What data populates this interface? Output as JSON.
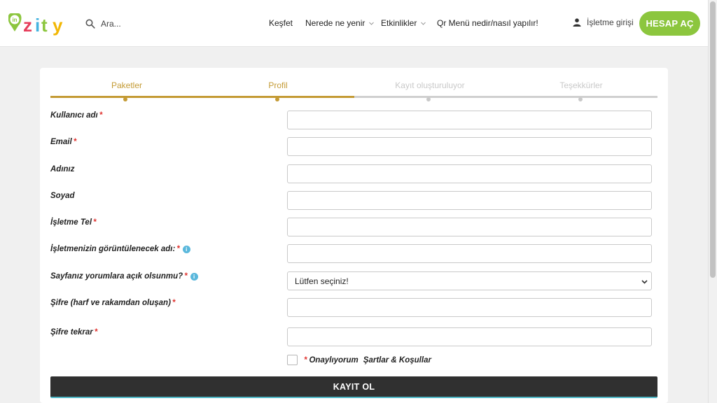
{
  "header": {
    "logo_text": "inzity",
    "search_placeholder": "Ara...",
    "nav": [
      {
        "label": "Keşfet",
        "has_caret": false
      },
      {
        "label": "Nerede ne yenir",
        "has_caret": true
      },
      {
        "label": "Etkinlikler",
        "has_caret": true
      },
      {
        "label": "Qr Menü nedir/nasıl yapılır!",
        "has_caret": false
      }
    ],
    "login_label": "İşletme girişi",
    "account_button": "HESAP AÇ"
  },
  "steps": [
    {
      "label": "Paketler",
      "status": "done"
    },
    {
      "label": "Profil",
      "status": "done"
    },
    {
      "label": "Kayıt oluşturuluyor",
      "status": "todo"
    },
    {
      "label": "Teşekkürler",
      "status": "todo"
    }
  ],
  "form": {
    "fields": [
      {
        "label": "Kullanıcı adı",
        "required": true,
        "info": false,
        "value": ""
      },
      {
        "label": "Email",
        "required": true,
        "info": false,
        "value": ""
      },
      {
        "label": "Adınız",
        "required": false,
        "info": false,
        "value": ""
      },
      {
        "label": "Soyad",
        "required": false,
        "info": false,
        "value": ""
      },
      {
        "label": "İşletme Tel",
        "required": true,
        "info": false,
        "value": ""
      },
      {
        "label": "İşletmenizin görüntülenecek adı:",
        "required": true,
        "info": true,
        "value": ""
      },
      {
        "label": "Sayfanız yorumlara açık olsunmu?",
        "required": true,
        "info": true,
        "select_value": "Lütfen seçiniz!"
      },
      {
        "label": "Şifre (harf ve rakamdan oluşan)",
        "required": true,
        "info": false,
        "value": ""
      },
      {
        "label": "Şifre tekrar",
        "required": true,
        "info": false,
        "value": ""
      }
    ],
    "required_mark": "*",
    "info_glyph": "i",
    "agree_text": "Onaylıyorum",
    "terms_text": "Şartlar & Koşullar",
    "submit_label": "KAYIT OL"
  },
  "colors": {
    "brand_green": "#8cc63e",
    "step_done": "#c49b35",
    "step_todo": "#d0d0d0",
    "required": "#e0332f",
    "info": "#5ab8dc",
    "submit_bg": "#303030"
  }
}
